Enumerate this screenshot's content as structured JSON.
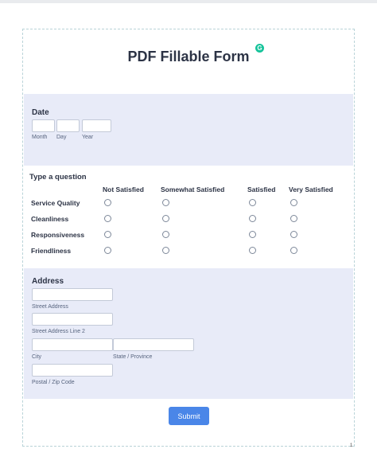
{
  "form": {
    "title": "PDF Fillable Form",
    "grammarly_icon": "G",
    "page_number": "1"
  },
  "date": {
    "label": "Date",
    "month": "Month",
    "day": "Day",
    "year": "Year"
  },
  "matrix": {
    "question": "Type a question",
    "columns": [
      "Not Satisfied",
      "Somewhat Satisfied",
      "Satisfied",
      "Very Satisfied"
    ],
    "rows": [
      "Service Quality",
      "Cleanliness",
      "Responsiveness",
      "Friendliness"
    ]
  },
  "address": {
    "label": "Address",
    "street": "Street Address",
    "street2": "Street Address Line 2",
    "city": "City",
    "state": "State / Province",
    "zip": "Postal / Zip Code"
  },
  "submit": {
    "label": "Submit",
    "color": "#4a86e8"
  }
}
